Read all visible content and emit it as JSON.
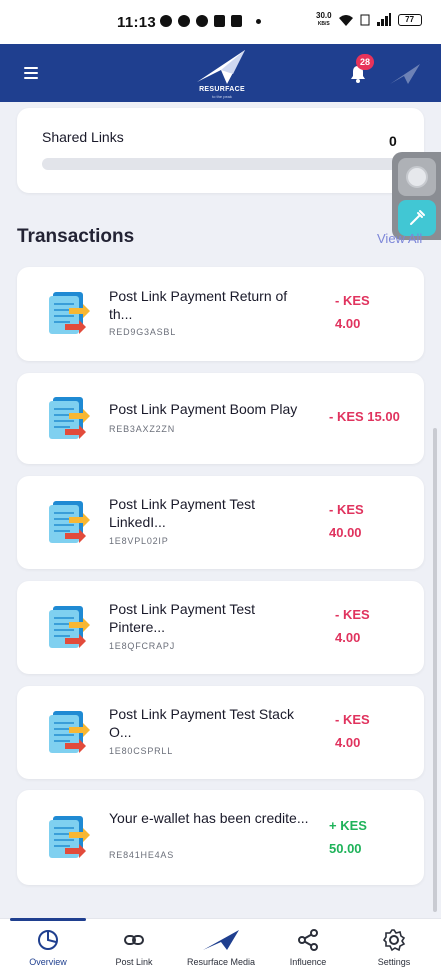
{
  "status_bar": {
    "time": "11:13",
    "net_speed_top": "30.0",
    "net_speed_bottom": "KB/S",
    "battery": "77"
  },
  "header": {
    "logo_text": "RESURFACE",
    "logo_sub": "to the peak",
    "notification_count": "28"
  },
  "shared_links": {
    "label": "Shared Links",
    "count": "0",
    "progress": 0
  },
  "transactions": {
    "title": "Transactions",
    "view_all": "View All",
    "items": [
      {
        "title": "Post Link Payment Return of th...",
        "ref": "RED9G3ASBL",
        "amount_line1": "- KES",
        "amount_line2": "4.00",
        "type": "debit"
      },
      {
        "title": "Post Link Payment Boom Play",
        "ref": "REB3AXZ2ZN",
        "amount_line1": "- KES 15.00",
        "amount_line2": "",
        "type": "debit"
      },
      {
        "title": "Post Link Payment Test LinkedI...",
        "ref": "1E8VPL02IP",
        "amount_line1": "- KES",
        "amount_line2": "40.00",
        "type": "debit"
      },
      {
        "title": "Post Link Payment Test Pintere...",
        "ref": "1E8QFCRAPJ",
        "amount_line1": "- KES",
        "amount_line2": "4.00",
        "type": "debit"
      },
      {
        "title": "Post Link Payment Test Stack O...",
        "ref": "1E80CSPRLL",
        "amount_line1": "- KES",
        "amount_line2": "4.00",
        "type": "debit"
      },
      {
        "title": "Your e-wallet has been credite...",
        "ref": "RE841HE4AS",
        "amount_line1": "+ KES",
        "amount_line2": "50.00",
        "type": "credit"
      }
    ]
  },
  "bottom_nav": [
    {
      "label": "Overview",
      "icon": "pie-chart-icon",
      "active": true
    },
    {
      "label": "Post Link",
      "icon": "link-icon",
      "active": false
    },
    {
      "label": "Resurface Media",
      "icon": "resurface-logo-icon",
      "active": false
    },
    {
      "label": "Influence",
      "icon": "share-icon",
      "active": false
    },
    {
      "label": "Settings",
      "icon": "gear-icon",
      "active": false
    }
  ],
  "colors": {
    "brand": "#1f3f8f",
    "debit": "#e0335e",
    "credit": "#1fb35a",
    "badge": "#e8335a",
    "view_all": "#7c86d8"
  }
}
